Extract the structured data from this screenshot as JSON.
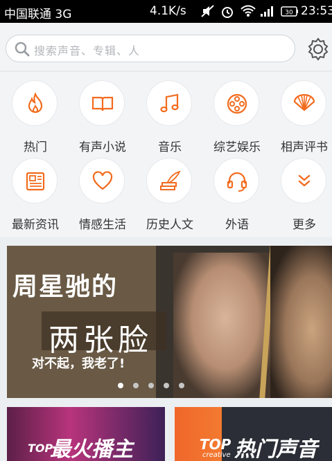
{
  "status_bar": {
    "carrier": "中国联通 3G",
    "speed": "4.1K/s",
    "battery": "30",
    "time": "23:53"
  },
  "search": {
    "placeholder": "搜索声音、专辑、人"
  },
  "categories": [
    {
      "label": "热门",
      "icon": "flame-icon"
    },
    {
      "label": "有声小说",
      "icon": "book-icon"
    },
    {
      "label": "音乐",
      "icon": "music-note-icon"
    },
    {
      "label": "综艺娱乐",
      "icon": "film-reel-icon"
    },
    {
      "label": "相声评书",
      "icon": "fan-icon"
    },
    {
      "label": "最新资讯",
      "icon": "newspaper-icon"
    },
    {
      "label": "情感生活",
      "icon": "heart-icon"
    },
    {
      "label": "历史人文",
      "icon": "books-quill-icon"
    },
    {
      "label": "外语",
      "icon": "headset-icon"
    },
    {
      "label": "更多",
      "icon": "chevron-down-double-icon"
    }
  ],
  "banner": {
    "title_main": "周星驰的",
    "title_sub": "两张脸",
    "caption": "对不起，我老了!",
    "slides": 5,
    "active_slide": 1
  },
  "cards": {
    "left": {
      "top": "TOP",
      "title": "最火播主"
    },
    "right": {
      "top": "TOP",
      "sub": "creative",
      "title": "热门声音"
    }
  },
  "colors": {
    "accent": "#f26b1d",
    "icon_stroke": "#f26b1d"
  }
}
